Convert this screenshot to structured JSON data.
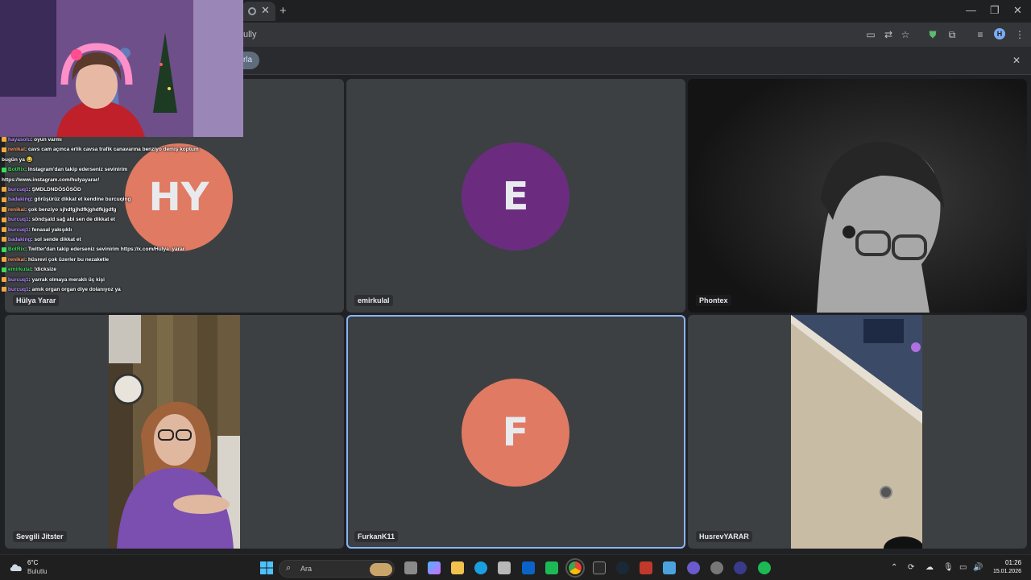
{
  "browser": {
    "tab_close": "✕",
    "new_tab": "+",
    "url_fragment": "ully",
    "window_buttons": [
      "—",
      "❐",
      "✕"
    ],
    "profile_initial": "H",
    "info_button": "rla",
    "info_close": "✕"
  },
  "participants": [
    {
      "name": "Hülya Yarar",
      "initials": "HY",
      "color": "#e07a63"
    },
    {
      "name": "emirkulal",
      "initials": "E",
      "color": "#6b2c80"
    },
    {
      "name": "Phontex"
    },
    {
      "name": "Sevgili Jitster"
    },
    {
      "name": "FurkanK11",
      "initials": "F",
      "color": "#e07a63"
    },
    {
      "name": "HusrevYARAR"
    }
  ],
  "chat": [
    {
      "user": "hayasolu",
      "text": ": oyun varmı",
      "color": "#b98bff"
    },
    {
      "user": "renikal",
      "text": ": cavs cam açınca erlik cavsa trafik canavarına benziyo demiş koptum",
      "color": "#ff9966"
    },
    {
      "user": "",
      "text": "bugün ya 😂",
      "color": "#ffffff"
    },
    {
      "user": "BotRix",
      "text": ": Instagram'dan takip ederseniz sevinirim",
      "color": "#3cdc5a"
    },
    {
      "user": "",
      "text": "https://www.instagram.com/hulyayarar/",
      "color": "#ffffff"
    },
    {
      "user": "burcuq1",
      "text": ": ŞMDLDNDÖSÖSÖD",
      "color": "#b98bff"
    },
    {
      "user": "badaking",
      "text": ": görüşürüz dikkat et kendine burcuqing",
      "color": "#b98bff"
    },
    {
      "user": "renikal",
      "text": ": çok benziyo sjhdfgjhdfkjghdfkjgdfg",
      "color": "#ff9966"
    },
    {
      "user": "burcuq1",
      "text": ": söndşald sağ abi sen de dikkat et",
      "color": "#b98bff"
    },
    {
      "user": "burcuq1",
      "text": ": fenasal yakışıklı",
      "color": "#b98bff"
    },
    {
      "user": "badaking",
      "text": ": sol sende dikkat et",
      "color": "#b98bff"
    },
    {
      "user": "BotRix",
      "text": ": Twitter'dan takip ederseniz sevinirim https://x.com/Hulya_yarar",
      "color": "#3cdc5a"
    },
    {
      "user": "renikal",
      "text": ": hüsrevi çok üzerler bu nezaketle",
      "color": "#ff9966"
    },
    {
      "user": "emirkulal",
      "text": ": !dicksize",
      "color": "#3cdc5a"
    },
    {
      "user": "burcuq1",
      "text": ": yarrak olmaya meraklı üç kişi",
      "color": "#b98bff"
    },
    {
      "user": "burcuq1",
      "text": ": amık organ organ diye dolanıyoz ya",
      "color": "#b98bff"
    }
  ],
  "taskbar": {
    "weather_temp": "6°C",
    "weather_desc": "Bulutlu",
    "search_placeholder": "Ara",
    "time": "01:26",
    "date": "15.01.2026"
  }
}
